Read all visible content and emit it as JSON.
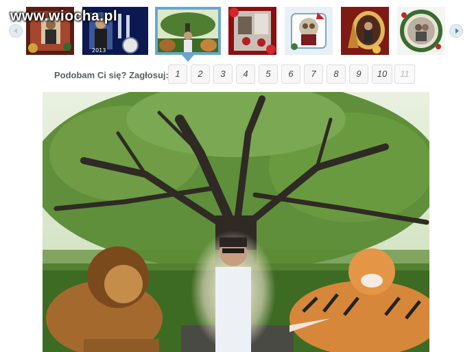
{
  "site": {
    "logo_text": "www.wiocha.pl"
  },
  "gallery": {
    "prev_icon": "chevron-left-icon",
    "next_icon": "chevron-right-icon",
    "thumbnails": [
      {
        "label": "photo-collage-christmas"
      },
      {
        "label": "photo-collage-new-year"
      },
      {
        "label": "photo-collage-tree-lion-tiger"
      },
      {
        "label": "photo-collage-roses"
      },
      {
        "label": "photo-collage-snowman"
      },
      {
        "label": "photo-collage-christmas-frame"
      },
      {
        "label": "photo-collage-oval-frame"
      }
    ],
    "active_index": 2
  },
  "vote": {
    "label": "Podobam Ci się? Zagłosuj:",
    "options": [
      "1",
      "2",
      "3",
      "4",
      "5",
      "6",
      "7",
      "8",
      "9",
      "10",
      "11"
    ],
    "disabled": [
      "11"
    ]
  },
  "colors": {
    "accent": "#6aa6cc",
    "label": "#555f68"
  }
}
